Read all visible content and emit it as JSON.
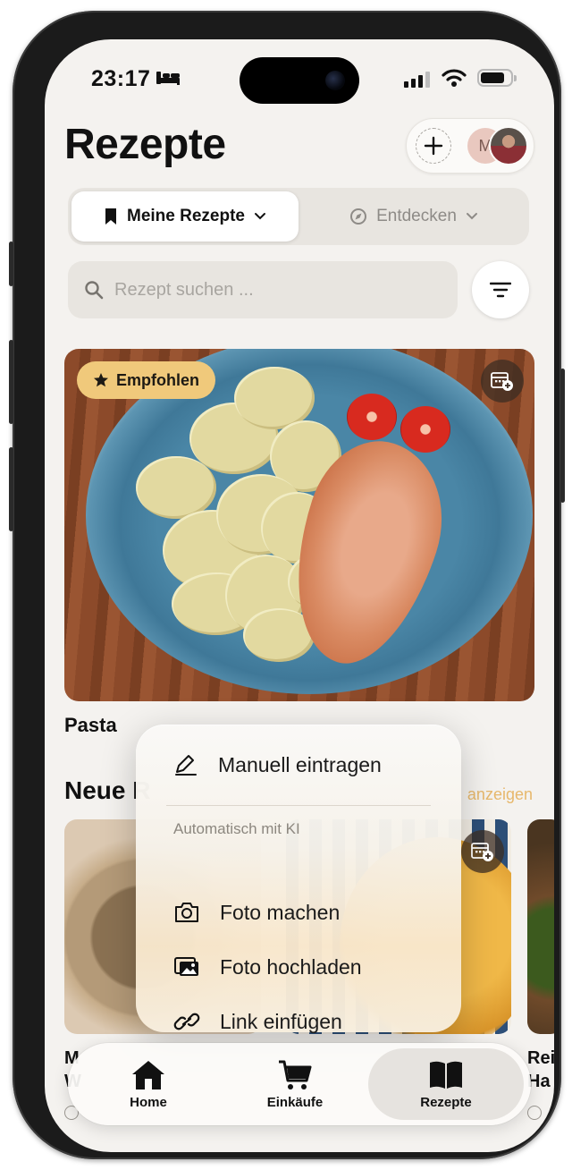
{
  "status_bar": {
    "time": "23:17"
  },
  "header": {
    "title": "Rezepte",
    "avatar_initial": "M"
  },
  "segments": [
    {
      "label": "Meine Rezepte",
      "active": true
    },
    {
      "label": "Entdecken",
      "active": false
    }
  ],
  "search": {
    "placeholder": "Rezept suchen ..."
  },
  "featured": {
    "badge": "Empfohlen",
    "title": "Pasta"
  },
  "new_section": {
    "title": "Neue R",
    "link": "anzeigen"
  },
  "new_cards": [
    {
      "title_lines": [
        "M",
        "W"
      ]
    },
    {
      "title_lines": []
    },
    {
      "title_lines": [
        "Rei",
        "Ha"
      ]
    }
  ],
  "menu": {
    "manual": "Manuell eintragen",
    "section_label": "Automatisch mit KI",
    "items": [
      "Foto machen",
      "Foto hochladen",
      "Link einfügen"
    ]
  },
  "tabbar": {
    "items": [
      {
        "label": "Home",
        "icon": "home-icon",
        "active": false
      },
      {
        "label": "Einkäufe",
        "icon": "cart-icon",
        "active": false
      },
      {
        "label": "Rezepte",
        "icon": "book-icon",
        "active": true
      }
    ]
  },
  "colors": {
    "background": "#f4f2ef",
    "badge": "#f0c97b",
    "link": "#e7b86c",
    "segment_bg": "#e8e5e0"
  }
}
